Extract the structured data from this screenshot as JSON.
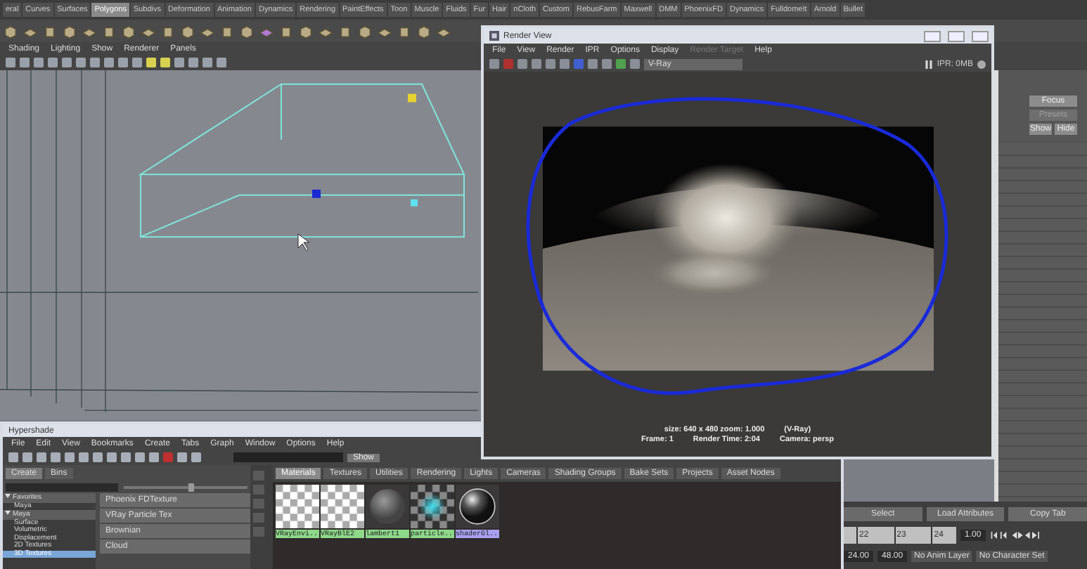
{
  "shelf": {
    "tabs": [
      {
        "label": "eral",
        "selected": false
      },
      {
        "label": "Curves",
        "selected": false
      },
      {
        "label": "Surfaces",
        "selected": false
      },
      {
        "label": "Polygons",
        "selected": true
      },
      {
        "label": "Subdivs",
        "selected": false
      },
      {
        "label": "Deformation",
        "selected": false
      },
      {
        "label": "Animation",
        "selected": false
      },
      {
        "label": "Dynamics",
        "selected": false
      },
      {
        "label": "Rendering",
        "selected": false
      },
      {
        "label": "PaintEffects",
        "selected": false
      },
      {
        "label": "Toon",
        "selected": false
      },
      {
        "label": "Muscle",
        "selected": false
      },
      {
        "label": "Fluids",
        "selected": false
      },
      {
        "label": "Fur",
        "selected": false
      },
      {
        "label": "Hair",
        "selected": false
      },
      {
        "label": "nCloth",
        "selected": false
      },
      {
        "label": "Custom",
        "selected": false
      },
      {
        "label": "RebusFarm",
        "selected": false
      },
      {
        "label": "Maxwell",
        "selected": false
      },
      {
        "label": "DMM",
        "selected": false
      },
      {
        "label": "PhoenixFD",
        "selected": false
      },
      {
        "label": "Dynamics",
        "selected": false
      },
      {
        "label": "FulldomeIt",
        "selected": false
      },
      {
        "label": "Arnold",
        "selected": false
      },
      {
        "label": "Bullet",
        "selected": false
      }
    ]
  },
  "viewport": {
    "menu": [
      "Shading",
      "Lighting",
      "Show",
      "Renderer",
      "Panels"
    ]
  },
  "attribute_editor": {
    "buttons": [
      {
        "label": "Focus",
        "disabled": false
      },
      {
        "label": "Presets",
        "disabled": true
      },
      {
        "label": "Show",
        "disabled": false
      },
      {
        "label": "Hide",
        "disabled": false
      }
    ]
  },
  "render_view": {
    "title": "Render View",
    "menu": [
      {
        "label": "File",
        "disabled": false
      },
      {
        "label": "View",
        "disabled": false
      },
      {
        "label": "Render",
        "disabled": false
      },
      {
        "label": "IPR",
        "disabled": false
      },
      {
        "label": "Options",
        "disabled": false
      },
      {
        "label": "Display",
        "disabled": false
      },
      {
        "label": "Render Target",
        "disabled": true
      },
      {
        "label": "Help",
        "disabled": false
      }
    ],
    "renderer": "V-Ray",
    "memory": "IPR: 0MB",
    "status": {
      "size": "size: 640 x 480 zoom: 1.000",
      "renderer": "(V-Ray)",
      "frame": "Frame: 1",
      "render_time": "Render Time: 2:04",
      "camera": "Camera: persp"
    }
  },
  "hypershade": {
    "title": "Hypershade",
    "menu": [
      "File",
      "Edit",
      "View",
      "Bookmarks",
      "Create",
      "Tabs",
      "Graph",
      "Window",
      "Options",
      "Help"
    ],
    "show_button": "Show",
    "icon_size_slider": {
      "level": 0.55
    },
    "create_tabs": [
      {
        "label": "Create",
        "selected": true
      },
      {
        "label": "Bins",
        "selected": false
      }
    ],
    "tree": [
      {
        "label": "Favorites",
        "expanded": true,
        "selected": false,
        "children": [
          {
            "label": "Maya",
            "selected": false
          }
        ]
      },
      {
        "label": "Maya",
        "expanded": true,
        "selected": false,
        "children": [
          {
            "label": "Surface",
            "selected": false
          },
          {
            "label": "Volumetric",
            "selected": false
          },
          {
            "label": "Displacement",
            "selected": false
          },
          {
            "label": "2D Textures",
            "selected": false
          },
          {
            "label": "3D Textures",
            "selected": true
          }
        ]
      }
    ],
    "nodes": [
      "Phoenix FDTexture",
      "VRay Particle Tex",
      "Brownian",
      "Cloud"
    ],
    "tabs": [
      {
        "label": "Materials",
        "selected": true
      },
      {
        "label": "Textures",
        "selected": false
      },
      {
        "label": "Utilities",
        "selected": false
      },
      {
        "label": "Rendering",
        "selected": false
      },
      {
        "label": "Lights",
        "selected": false
      },
      {
        "label": "Cameras",
        "selected": false
      },
      {
        "label": "Shading Groups",
        "selected": false
      },
      {
        "label": "Bake Sets",
        "selected": false
      },
      {
        "label": "Projects",
        "selected": false
      },
      {
        "label": "Asset Nodes",
        "selected": false
      }
    ],
    "swatches": [
      {
        "label": "VRayEnvi...",
        "kind": "checker",
        "selected": false
      },
      {
        "label": "VRayBlE2",
        "kind": "checker",
        "selected": false
      },
      {
        "label": "lambert1",
        "kind": "sphere",
        "selected": false
      },
      {
        "label": "particle...",
        "kind": "particle",
        "selected": false
      },
      {
        "label": "shaderGl...",
        "kind": "shiny",
        "selected": true
      }
    ]
  },
  "time_controls": {
    "buttons": [
      "Select",
      "Load Attributes",
      "Copy Tab"
    ],
    "ticks": [
      "22",
      "23",
      "24"
    ],
    "current_frame": "1.00",
    "end_time": "24.00",
    "end_playback": "48.00",
    "anim_layer": "No Anim Layer",
    "character_set": "No Character Set"
  }
}
